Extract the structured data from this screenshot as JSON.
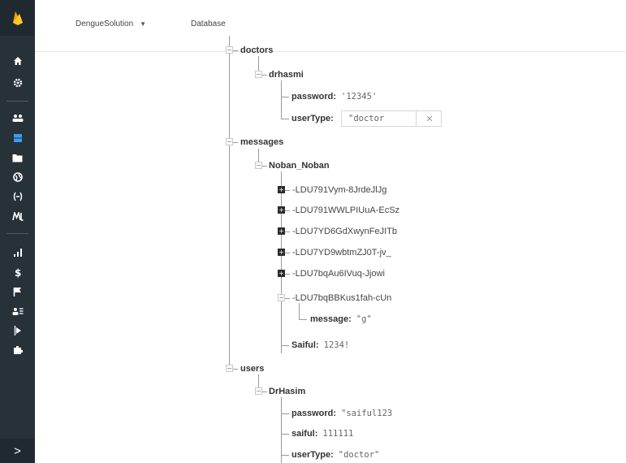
{
  "colors": {
    "rail": "#263238",
    "rail_active": "#3e9bf0",
    "logo": "#ffca28"
  },
  "rail": {
    "items": [
      {
        "name": "home-icon",
        "glyph": "⌂"
      },
      {
        "name": "settings-icon",
        "glyph": "⚙"
      },
      {
        "name": "authentication-icon",
        "glyph": "👥"
      },
      {
        "name": "database-icon",
        "glyph": "▤"
      },
      {
        "name": "storage-icon",
        "glyph": "▬"
      },
      {
        "name": "hosting-icon",
        "glyph": "◉"
      },
      {
        "name": "functions-icon",
        "glyph": "(·)"
      },
      {
        "name": "ml-kit-icon",
        "glyph": "M"
      },
      {
        "name": "analytics-icon",
        "glyph": "▁▃▇"
      },
      {
        "name": "grow-icon",
        "glyph": "$"
      },
      {
        "name": "flag-icon",
        "glyph": "⚑"
      },
      {
        "name": "users-icon",
        "glyph": "☰"
      },
      {
        "name": "test-lab-icon",
        "glyph": "▶"
      },
      {
        "name": "extensions-icon",
        "glyph": "✱"
      }
    ],
    "expand_glyph": ">"
  },
  "header": {
    "project": "DengueSolution",
    "caret": "▼",
    "section": "Database"
  },
  "tree": {
    "doctors": "doctors",
    "drhasmi": "drhasmi",
    "drhasmi_password_key": "password:",
    "drhasmi_password_val": "'12345'",
    "drhasmi_usertype_key": "userType:",
    "drhasmi_usertype_val": "\"doctor",
    "clear_glyph": "✕",
    "messages": "messages",
    "noban": "Noban_Noban",
    "push_ids": [
      "-LDU791Vym-8JrdeJlJg",
      "-LDU791WWLPIUuA-EcSz",
      "-LDU7YD6GdXwynFeJITb",
      "-LDU7YD9wbtmZJ0T-jv_",
      "-LDU7bqAu6IVuq-Jjowi",
      "-LDU7bqBBKus1fah-cUn"
    ],
    "message_key": "message:",
    "message_val": "\"g\"",
    "saiful_key": "Saiful:",
    "saiful_val": "1234!",
    "users": "users",
    "drhasim": "DrHasim",
    "drhasim_password_key": "password:",
    "drhasim_password_val": "\"saiful123",
    "drhasim_saiful_key": "saiful:",
    "drhasim_saiful_val": "111111",
    "drhasim_usertype_key": "userType:",
    "drhasim_usertype_val": "\"doctor\""
  }
}
